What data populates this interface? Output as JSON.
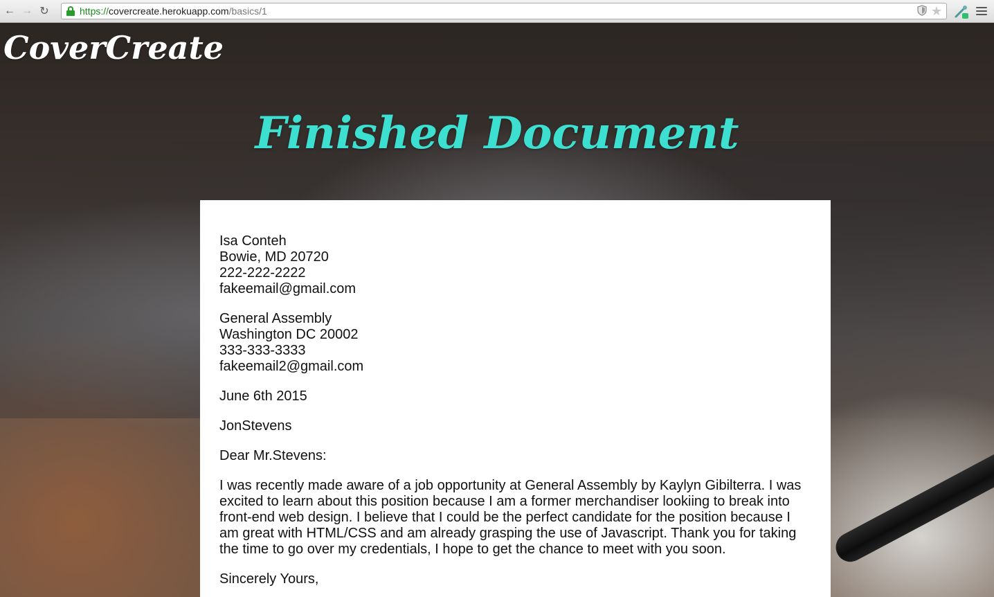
{
  "browser": {
    "url_scheme": "https://",
    "url_host": "covercreate.herokuapp.com",
    "url_path": "/basics/1"
  },
  "app": {
    "brand": "CoverCreate"
  },
  "page": {
    "heading": "Finished Document"
  },
  "letter": {
    "sender": [
      "Isa Conteh",
      "Bowie, MD 20720",
      "222-222-2222",
      "fakeemail@gmail.com"
    ],
    "recipient": [
      "General Assembly",
      "Washington DC 20002",
      "333-333-3333",
      "fakeemail2@gmail.com"
    ],
    "date": "June 6th 2015",
    "contact_name": "JonStevens",
    "salutation": "Dear Mr.Stevens:",
    "body": "I was recently made aware of a job opportunity at General Assembly by Kaylyn Gibilterra. I was excited to learn about this position because I am a former merchandiser lookiing to break into front-end web design. I believe that I could be the perfect candidate for the position because I am great with HTML/CSS and am already grasping the use of Javascript. Thank you for taking the time to go over my credentials, I hope to get the chance to meet with you soon.",
    "closing": "Sincerely Yours,"
  },
  "colors": {
    "heading": "#3de0d0",
    "brand": "#ffffff",
    "lock": "#2a9a2a"
  }
}
